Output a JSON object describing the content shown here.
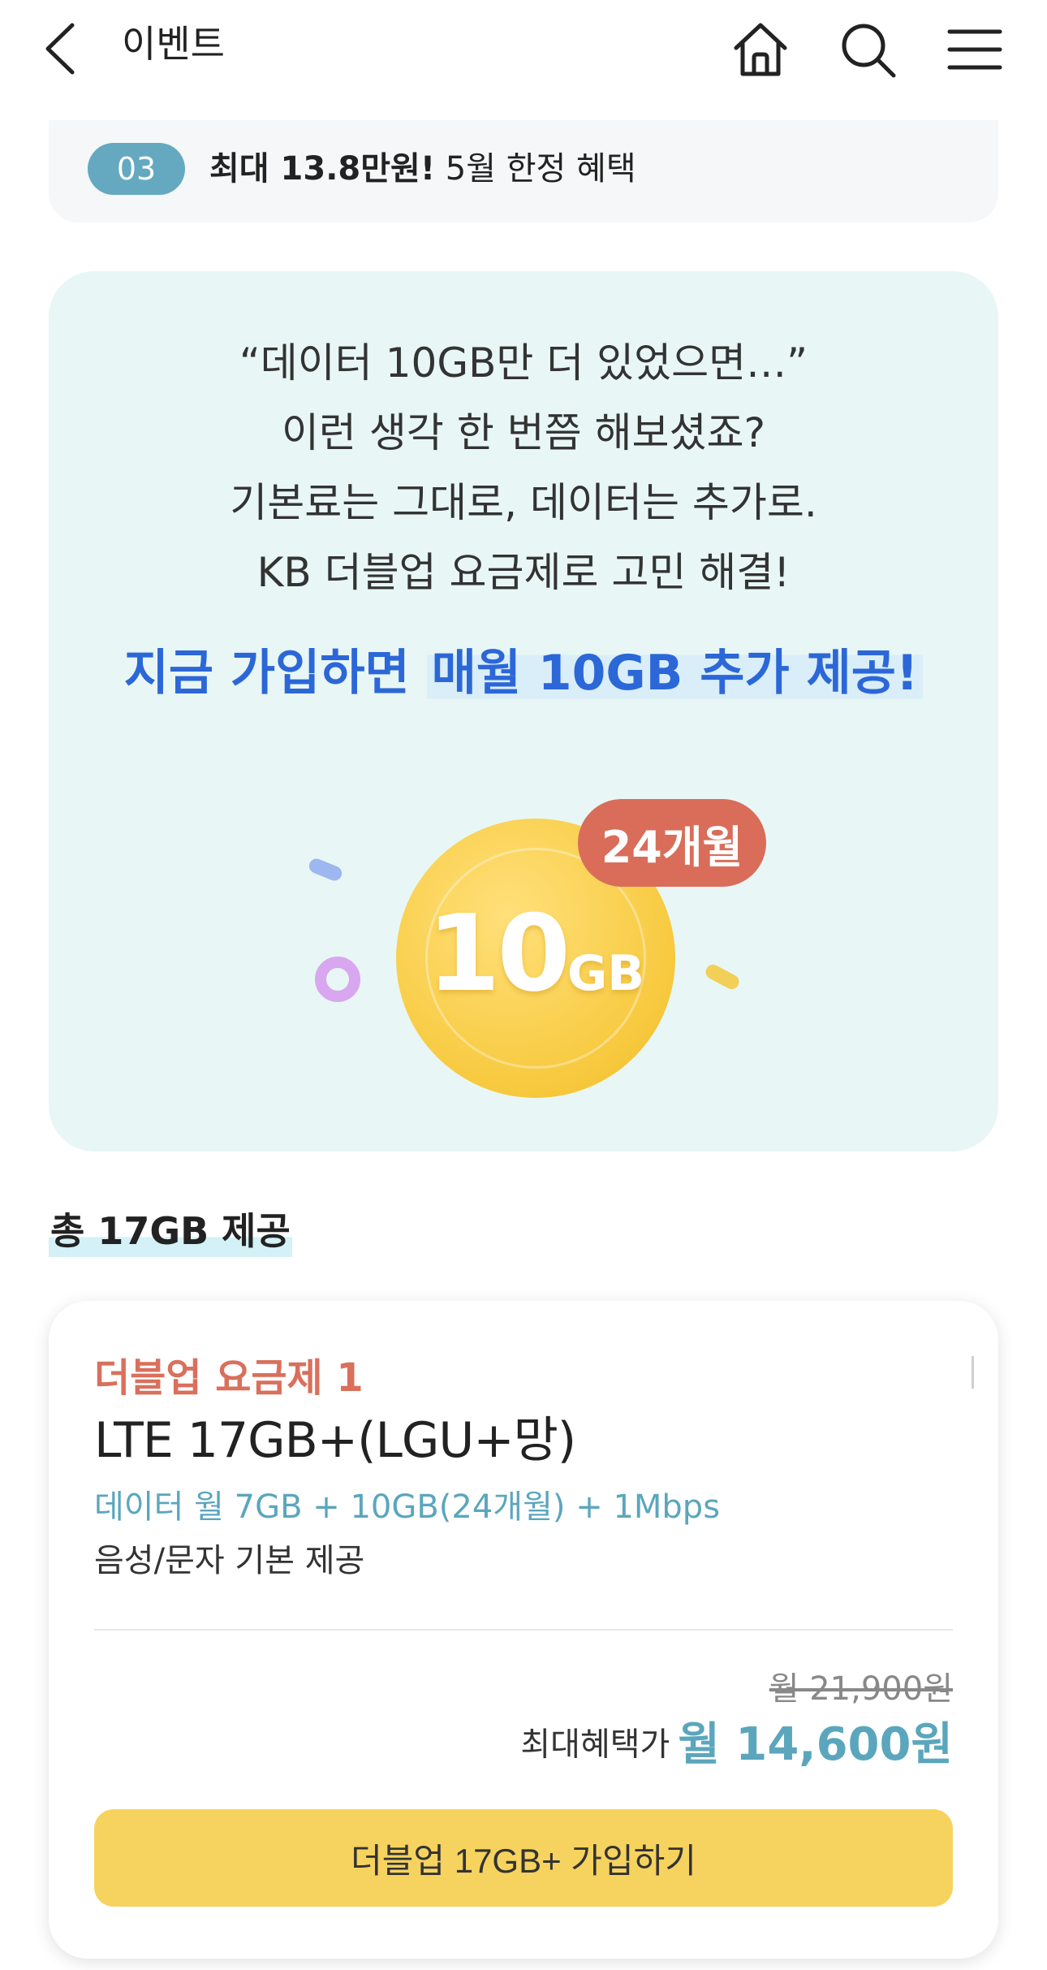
{
  "header": {
    "title": "이벤트",
    "icons": [
      "back-arrow-icon",
      "home-icon",
      "search-icon",
      "menu-icon"
    ]
  },
  "benefit_strip": {
    "step_number": "03",
    "highlight": "최대 13.8만원!",
    "text": " 5월 한정 혜택"
  },
  "promo": {
    "quote_lines": [
      "“데이터 10GB만 더 있었으면…”",
      "이런 생각 한 번쯤 해보셨죠?",
      "기본료는 그대로, 데이터는 추가로.",
      "KB 더블업 요금제로 고민 해결!"
    ],
    "headline_prefix": "지금 가입하면 ",
    "headline_highlight": "매월 10GB 추가 제공!",
    "coin_amount": "10",
    "coin_unit": "GB",
    "months_badge": "24개월"
  },
  "section": {
    "title": "총 17GB 제공"
  },
  "plan": {
    "kicker": "더블업 요금제 1",
    "name": "LTE 17GB+(LGU+망)",
    "data_desc": "데이터 월 7GB + 10GB(24개월) + 1Mbps",
    "voice_desc": "음성/문자 기본 제공",
    "original_price": "월 21,900원",
    "price_label": "최대혜택가",
    "price": "월 14,600원",
    "join_button": "더블업 17GB+ 가입하기"
  },
  "colors": {
    "accent_teal": "#5ba6bd",
    "badge_teal": "#64a9c0",
    "headline_blue": "#2c67d8",
    "kicker_coral": "#d9705c",
    "button_yellow": "#f6d35f",
    "promo_bg": "#e8f7f5"
  }
}
